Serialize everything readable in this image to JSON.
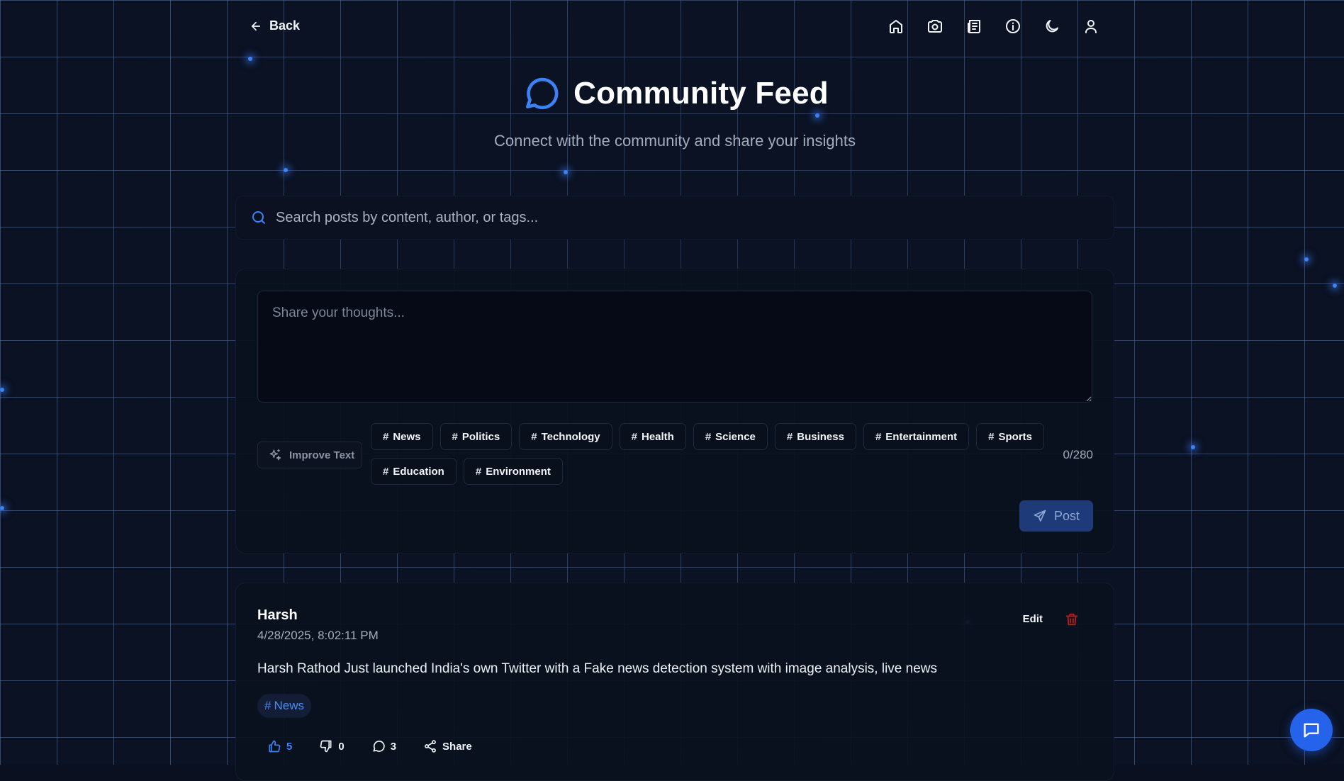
{
  "nav": {
    "back_label": "Back",
    "icons": [
      "home-icon",
      "camera-icon",
      "newspaper-icon",
      "info-icon",
      "moon-icon",
      "user-icon"
    ]
  },
  "header": {
    "title": "Community Feed",
    "subtitle": "Connect with the community and share your insights"
  },
  "search": {
    "placeholder": "Search posts by content, author, or tags..."
  },
  "composer": {
    "placeholder": "Share your thoughts...",
    "improve_label": "Improve Text",
    "tags": [
      "News",
      "Politics",
      "Technology",
      "Health",
      "Science",
      "Business",
      "Entertainment",
      "Sports",
      "Education",
      "Environment"
    ],
    "counter": "0/280",
    "post_label": "Post"
  },
  "posts": [
    {
      "author": "Harsh",
      "timestamp": "4/28/2025, 8:02:11 PM",
      "edit_label": "Edit",
      "content": "Harsh Rathod Just launched India's own Twitter with a Fake news detection system with image analysis, live news",
      "tag": "News",
      "likes": "5",
      "dislikes": "0",
      "comments": "3",
      "share_label": "Share"
    }
  ],
  "colors": {
    "accent": "#3b82f6",
    "background": "#0b1224",
    "delete": "#b91c1c"
  }
}
